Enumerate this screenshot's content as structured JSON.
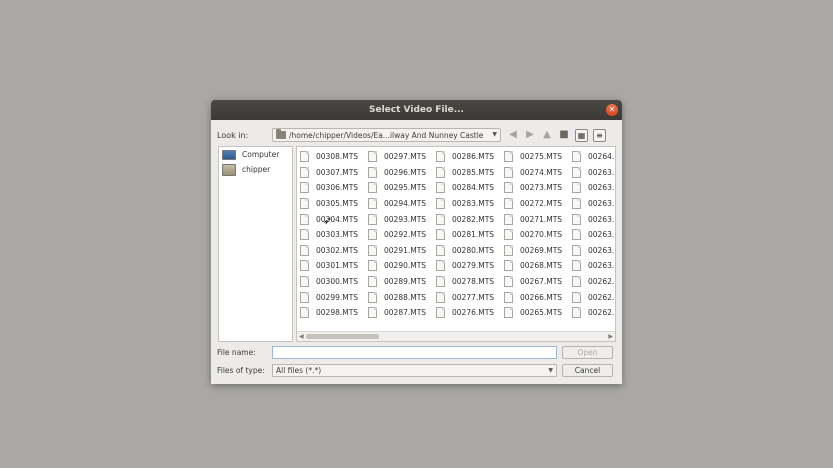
{
  "dialog": {
    "title": "Select Video File...",
    "look_in_label": "Look in:",
    "path": "/home/chipper/Videos/Ea...ilway And Nunney Castle",
    "file_name_label": "File name:",
    "file_name_value": "",
    "files_of_type_label": "Files of type:",
    "files_of_type_value": "All files (*.*)",
    "open_label": "Open",
    "cancel_label": "Cancel"
  },
  "sidebar": {
    "items": [
      {
        "label": "Computer",
        "icon": "computer-icon"
      },
      {
        "label": "chipper",
        "icon": "home-folder-icon"
      }
    ]
  },
  "files": {
    "columns": [
      [
        "00308.MTS",
        "00307.MTS",
        "00306.MTS",
        "00305.MTS",
        "00304.MTS",
        "00303.MTS",
        "00302.MTS",
        "00301.MTS",
        "00300.MTS",
        "00299.MTS",
        "00298.MTS"
      ],
      [
        "00297.MTS",
        "00296.MTS",
        "00295.MTS",
        "00294.MTS",
        "00293.MTS",
        "00292.MTS",
        "00291.MTS",
        "00290.MTS",
        "00289.MTS",
        "00288.MTS",
        "00287.MTS"
      ],
      [
        "00286.MTS",
        "00285.MTS",
        "00284.MTS",
        "00283.MTS",
        "00282.MTS",
        "00281.MTS",
        "00280.MTS",
        "00279.MTS",
        "00278.MTS",
        "00277.MTS",
        "00276.MTS"
      ],
      [
        "00275.MTS",
        "00274.MTS",
        "00273.MTS",
        "00272.MTS",
        "00271.MTS",
        "00270.MTS",
        "00269.MTS",
        "00268.MTS",
        "00267.MTS",
        "00266.MTS",
        "00265.MTS"
      ],
      [
        "00264.",
        "00263.",
        "00263.",
        "00263.",
        "00263.",
        "00263.",
        "00263.",
        "00263.",
        "00262.",
        "00262.",
        "00262."
      ]
    ]
  }
}
